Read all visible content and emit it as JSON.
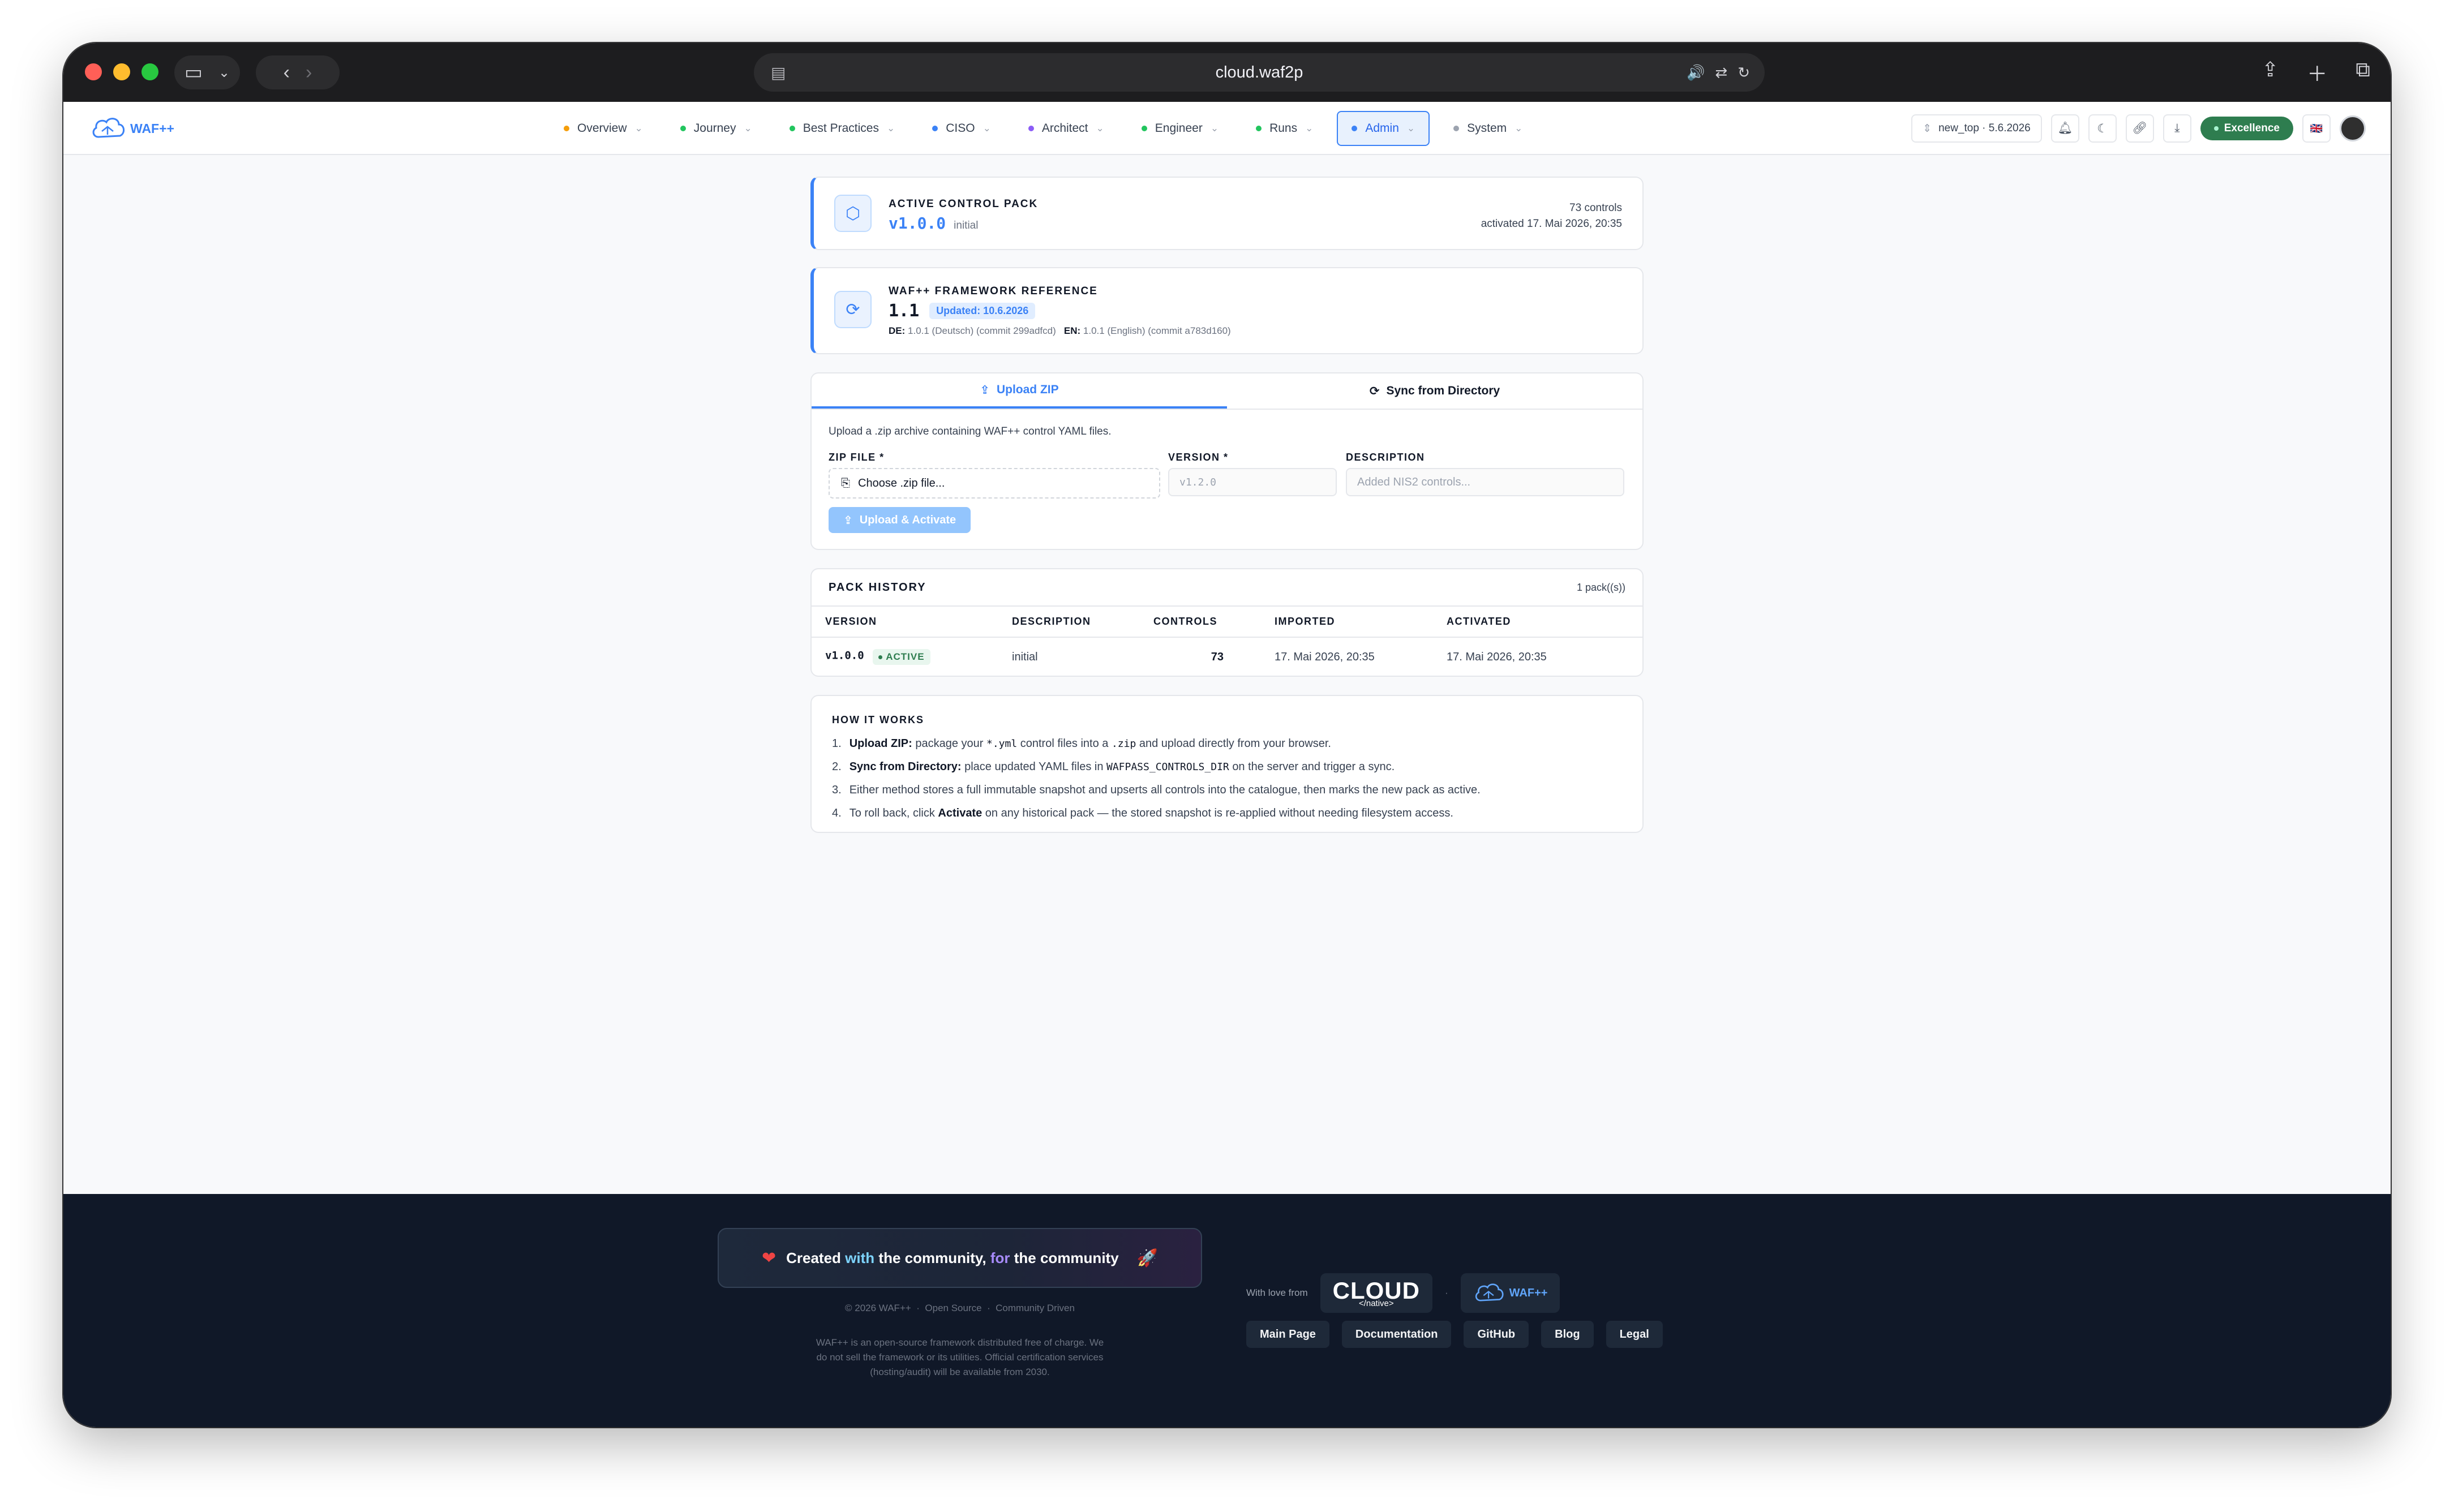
{
  "browser": {
    "url": "cloud.waf2p",
    "colors": {
      "close": "#ff5f57",
      "minimize": "#febc2e",
      "zoom": "#28c840"
    }
  },
  "app": {
    "logo_text": "WAF++",
    "nav": [
      {
        "label": "Overview",
        "dot": "#f59e0b"
      },
      {
        "label": "Journey",
        "dot": "#22c55e"
      },
      {
        "label": "Best Practices",
        "dot": "#22c55e"
      },
      {
        "label": "CISO",
        "dot": "#3b82f6"
      },
      {
        "label": "Architect",
        "dot": "#8b5cf6"
      },
      {
        "label": "Engineer",
        "dot": "#22c55e"
      },
      {
        "label": "Runs",
        "dot": "#22c55e"
      },
      {
        "label": "Admin",
        "dot": "#3b82f6"
      },
      {
        "label": "System",
        "dot": "#9ca3af"
      }
    ],
    "workspace": "new_top · 5.6.2026",
    "badge": "Excellence",
    "flag": "🇬🇧"
  },
  "active_pack": {
    "kicker": "ACTIVE CONTROL PACK",
    "version": "v1.0.0",
    "description": "initial",
    "controls": "73 controls",
    "activated": "activated 17. Mai 2026, 20:35"
  },
  "framework": {
    "kicker": "WAF++ FRAMEWORK REFERENCE",
    "version": "1.1",
    "updated": "Updated: 10.6.2026",
    "de_label": "DE:",
    "de_value": "1.0.1 (Deutsch) (commit 299adfcd)",
    "en_label": "EN:",
    "en_value": "1.0.1 (English) (commit a783d160)"
  },
  "upload": {
    "tabs": [
      "Upload ZIP",
      "Sync from Directory"
    ],
    "intro": "Upload a .zip archive containing WAF++ control YAML files.",
    "zip_label": "ZIP FILE *",
    "zip_button": "Choose .zip file...",
    "version_label": "VERSION *",
    "version_placeholder": "v1.2.0",
    "description_label": "DESCRIPTION",
    "description_placeholder": "Added NIS2 controls...",
    "submit": "Upload & Activate"
  },
  "history": {
    "title": "PACK HISTORY",
    "count": "1 pack((s))",
    "columns": [
      "VERSION",
      "DESCRIPTION",
      "CONTROLS",
      "IMPORTED",
      "ACTIVATED"
    ],
    "rows": [
      {
        "version": "v1.0.0",
        "badge": "ACTIVE",
        "description": "initial",
        "controls": "73",
        "imported": "17. Mai 2026, 20:35",
        "activated": "17. Mai 2026, 20:35"
      }
    ]
  },
  "how": {
    "title": "HOW IT WORKS",
    "s1_num": "1.",
    "s1_bold": "Upload ZIP:",
    "s1_a": "package your",
    "s1_code1": "*.yml",
    "s1_b": "control files into a",
    "s1_code2": ".zip",
    "s1_c": "and upload directly from your browser.",
    "s2_num": "2.",
    "s2_bold": "Sync from Directory:",
    "s2_a": "place updated YAML files in",
    "s2_code": "WAFPASS_CONTROLS_DIR",
    "s2_b": "on the server and trigger a sync.",
    "s3_num": "3.",
    "s3_text": "Either method stores a full immutable snapshot and upserts all controls into the catalogue, then marks the new pack as active.",
    "s4_num": "4.",
    "s4_a": "To roll back, click",
    "s4_bold": "Activate",
    "s4_b": "on any historical pack — the stored snapshot is re-applied without needing filesystem access."
  },
  "footer": {
    "c_created": "Created",
    "c_with": "with",
    "c_mid": "the community,",
    "c_for": "for",
    "c_end": "the community",
    "copyright": "© 2026 WAF++",
    "open_source": "Open Source",
    "community_driven": "Community Driven",
    "sep": "·",
    "desc": "WAF++ is an open-source framework distributed free of charge. We do not sell the framework or its utilities. Official certification services (hosting/audit) will be available from 2030.",
    "with_love": "With love from",
    "cloud_brand": "CLOUD",
    "cloud_sub": "</native>",
    "waf_brand": "WAF++",
    "links": [
      "Main Page",
      "Documentation",
      "GitHub",
      "Blog",
      "Legal"
    ]
  }
}
